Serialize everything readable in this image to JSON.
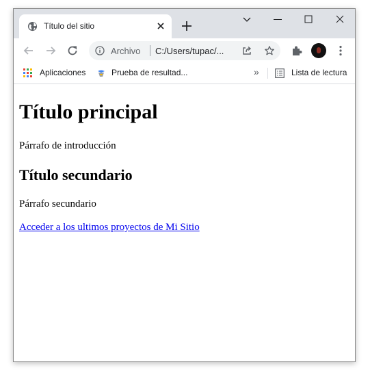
{
  "tab": {
    "title": "Título del sitio"
  },
  "address_bar": {
    "scheme_label": "Archivo",
    "url": "C:/Users/tupac/..."
  },
  "bookmarks": {
    "items": [
      {
        "label": "Aplicaciones",
        "icon": "apps-grid-icon"
      },
      {
        "label": "Prueba de resultad...",
        "icon": "test-flask-icon"
      }
    ],
    "overflow_label": "»",
    "reading_list_label": "Lista de lectura"
  },
  "page": {
    "h1": "Título principal",
    "intro": "Párrafo de introducción",
    "h2": "Título secundario",
    "secondary": "Párrafo secundario",
    "link": "Acceder a los ultimos proyectos de Mi Sitio"
  },
  "colors": {
    "tabstrip_bg": "#dee1e6",
    "omnibox_bg": "#f1f3f4",
    "link": "#0000ee"
  }
}
